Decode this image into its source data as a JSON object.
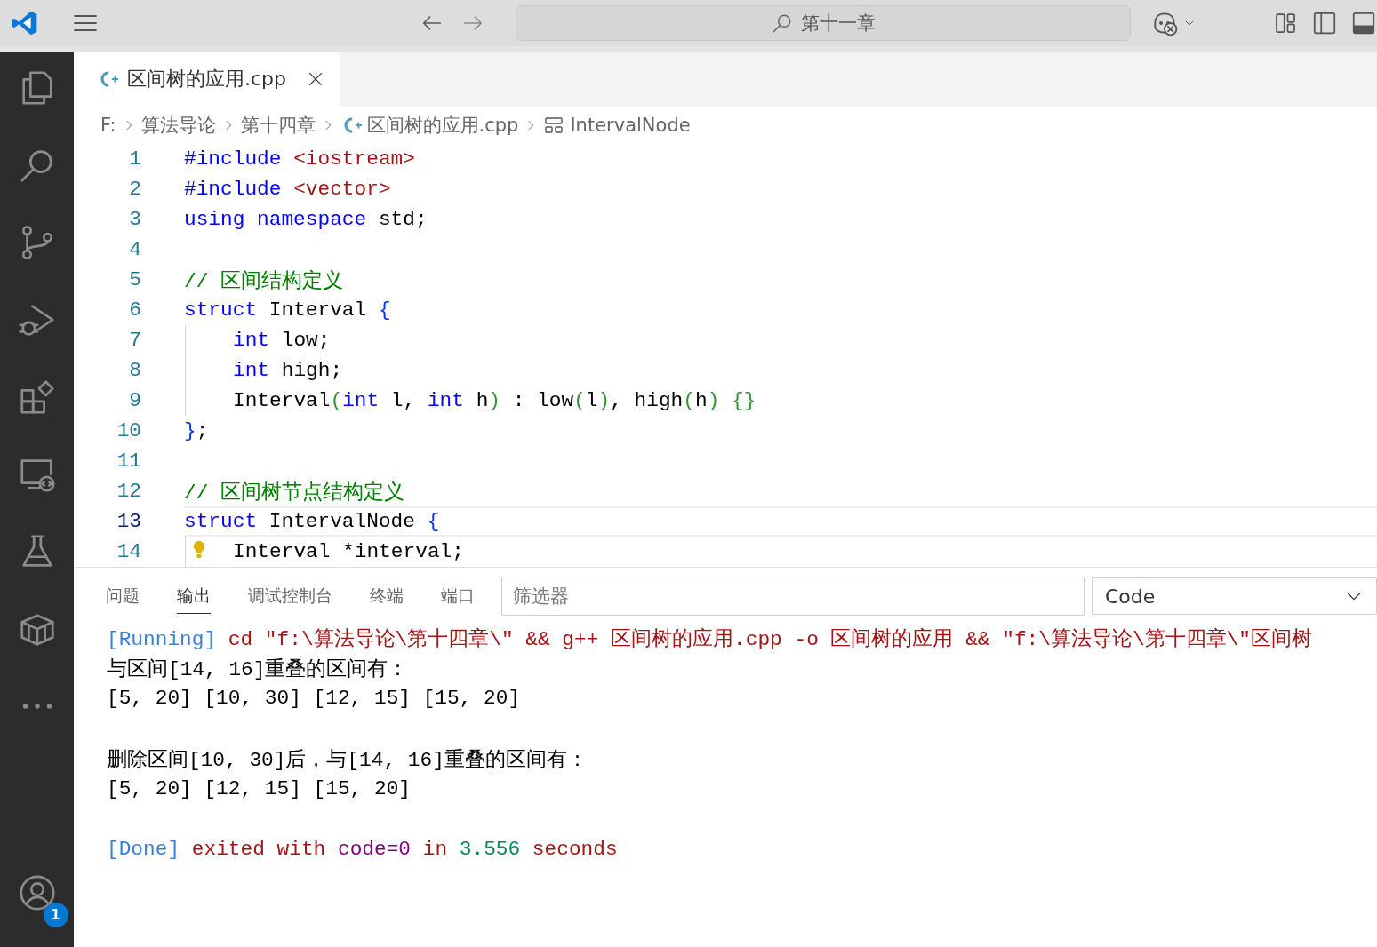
{
  "title_bar": {
    "search": {
      "value": "第十一章"
    }
  },
  "activity_bar": {
    "account": {
      "badge": "1"
    }
  },
  "tabs": [
    {
      "label": "区间树的应用.cpp",
      "selected": true
    }
  ],
  "breadcrumbs": [
    {
      "kind": "text",
      "label": "F:"
    },
    {
      "kind": "text",
      "label": "算法导论"
    },
    {
      "kind": "text",
      "label": "第十四章"
    },
    {
      "kind": "file",
      "label": "区间树的应用.cpp"
    },
    {
      "kind": "struct",
      "label": "IntervalNode"
    }
  ],
  "editor": {
    "lines": [
      {
        "number": "1",
        "current": false,
        "indent_guide": false,
        "lightbulb": false,
        "tokens": [
          {
            "text": "#include",
            "kind": "keyword"
          },
          {
            "text": " <iostream>",
            "kind": "string"
          }
        ]
      },
      {
        "number": "2",
        "current": false,
        "indent_guide": false,
        "lightbulb": false,
        "tokens": [
          {
            "text": "#include",
            "kind": "keyword"
          },
          {
            "text": " <vector>",
            "kind": "string"
          }
        ]
      },
      {
        "number": "3",
        "current": false,
        "indent_guide": false,
        "lightbulb": false,
        "tokens": [
          {
            "text": "using namespace",
            "kind": "keyword"
          },
          {
            "text": " std;",
            "kind": "plain"
          }
        ]
      },
      {
        "number": "4",
        "current": false,
        "indent_guide": false,
        "lightbulb": false
      },
      {
        "number": "5",
        "current": false,
        "indent_guide": false,
        "lightbulb": false,
        "tokens": [
          {
            "text": "// 区间结构定义",
            "kind": "comment"
          }
        ]
      },
      {
        "number": "6",
        "current": false,
        "indent_guide": false,
        "lightbulb": false,
        "tokens": [
          {
            "text": "struct",
            "kind": "keyword"
          },
          {
            "text": " Interval ",
            "kind": "plain"
          },
          {
            "text": "{",
            "kind": "bracket"
          }
        ]
      },
      {
        "number": "7",
        "current": false,
        "indent_guide": true,
        "lightbulb": false,
        "tokens": [
          {
            "text": "int",
            "kind": "keyword"
          },
          {
            "text": " low;",
            "kind": "plain"
          }
        ]
      },
      {
        "number": "8",
        "current": false,
        "indent_guide": true,
        "lightbulb": false,
        "tokens": [
          {
            "text": "int",
            "kind": "keyword"
          },
          {
            "text": " high;",
            "kind": "plain"
          }
        ]
      },
      {
        "number": "9",
        "current": false,
        "indent_guide": true,
        "lightbulb": false,
        "tokens": [
          {
            "text": "Interval",
            "kind": "plain"
          },
          {
            "text": "(",
            "kind": "paren"
          },
          {
            "text": "int",
            "kind": "keyword"
          },
          {
            "text": " l, ",
            "kind": "plain"
          },
          {
            "text": "int",
            "kind": "keyword"
          },
          {
            "text": " h",
            "kind": "plain"
          },
          {
            "text": ")",
            "kind": "paren"
          },
          {
            "text": " : low",
            "kind": "plain"
          },
          {
            "text": "(",
            "kind": "paren"
          },
          {
            "text": "l",
            "kind": "plain"
          },
          {
            "text": ")",
            "kind": "paren"
          },
          {
            "text": ", high",
            "kind": "plain"
          },
          {
            "text": "(",
            "kind": "paren"
          },
          {
            "text": "h",
            "kind": "plain"
          },
          {
            "text": ")",
            "kind": "paren"
          },
          {
            "text": " {}",
            "kind": "paren"
          }
        ]
      },
      {
        "number": "10",
        "current": false,
        "indent_guide": false,
        "lightbulb": false,
        "tokens": [
          {
            "text": "}",
            "kind": "bracket"
          },
          {
            "text": ";",
            "kind": "plain"
          }
        ]
      },
      {
        "number": "11",
        "current": false,
        "indent_guide": false,
        "lightbulb": false
      },
      {
        "number": "12",
        "current": false,
        "indent_guide": false,
        "lightbulb": false,
        "tokens": [
          {
            "text": "// 区间树节点结构定义",
            "kind": "comment"
          }
        ]
      },
      {
        "number": "13",
        "current": true,
        "indent_guide": false,
        "lightbulb": false,
        "tokens": [
          {
            "text": "struct",
            "kind": "keyword"
          },
          {
            "text": " IntervalNode ",
            "kind": "plain"
          },
          {
            "text": "{",
            "kind": "bracket"
          }
        ]
      },
      {
        "number": "14",
        "current": false,
        "indent_guide": true,
        "lightbulb": true,
        "tokens": [
          {
            "text": "Interval *interval;",
            "kind": "plain"
          }
        ]
      }
    ]
  },
  "panel": {
    "tabs": [
      {
        "label": "问题",
        "selected": false
      },
      {
        "label": "输出",
        "selected": true
      },
      {
        "label": "调试控制台",
        "selected": false
      },
      {
        "label": "终端",
        "selected": false
      },
      {
        "label": "端口",
        "selected": false
      }
    ],
    "filter": {
      "placeholder": "筛选器"
    },
    "channel": {
      "value": "Code"
    },
    "output": [
      {
        "lines": [
          {
            "tokens": [
              {
                "text": "[Running]",
                "kind": "info"
              },
              {
                "text": " cd \"f:\\算法导论\\第十四章\\\" && g++ 区间树的应用.cpp -o 区间树的应用 && \"f:\\算法导论\\第十四章\\\"区间树",
                "kind": "error"
              }
            ]
          },
          {
            "tokens": [
              {
                "text": "与区间[14, 16]重叠的区间有：",
                "kind": "plain"
              }
            ]
          },
          {
            "tokens": [
              {
                "text": "[5, 20] [10, 30] [12, 15] [15, 20]",
                "kind": "plain"
              }
            ]
          }
        ]
      },
      {
        "lines": [
          {
            "tokens": [
              {
                "text": "删除区间[10, 30]后，与[14, 16]重叠的区间有：",
                "kind": "plain"
              }
            ]
          },
          {
            "tokens": [
              {
                "text": "[5, 20] [12, 15] [15, 20]",
                "kind": "plain"
              }
            ]
          }
        ]
      },
      {
        "lines": [
          {
            "tokens": [
              {
                "text": "[Done]",
                "kind": "info"
              },
              {
                "text": " exited with ",
                "kind": "error"
              },
              {
                "text": "code=0",
                "kind": "purple"
              },
              {
                "text": " in ",
                "kind": "error"
              },
              {
                "text": "3.556",
                "kind": "number"
              },
              {
                "text": " seconds",
                "kind": "error"
              }
            ]
          }
        ]
      }
    ]
  }
}
